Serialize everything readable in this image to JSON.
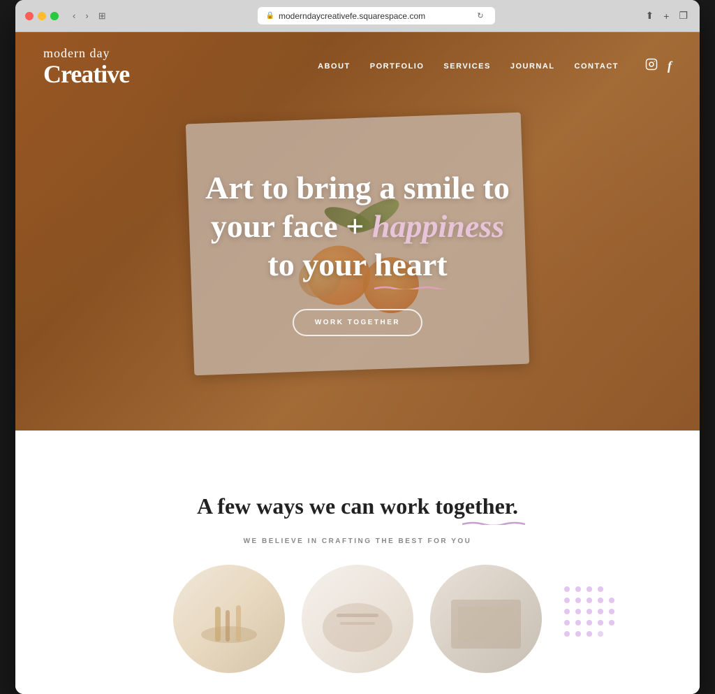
{
  "browser": {
    "url": "moderndaycreativefe.squarespace.com",
    "reload_label": "↻",
    "back_label": "‹",
    "forward_label": "›",
    "share_label": "⬆",
    "add_tab_label": "+",
    "duplicate_label": "❐",
    "window_icon_label": "⊞"
  },
  "site": {
    "logo_script": "modern day",
    "logo_serif": "Creative"
  },
  "nav": {
    "items": [
      {
        "label": "ABOUT",
        "id": "about"
      },
      {
        "label": "PORTFOLIO",
        "id": "portfolio"
      },
      {
        "label": "SERVICES",
        "id": "services"
      },
      {
        "label": "JOURNAL",
        "id": "journal"
      },
      {
        "label": "CONTACT",
        "id": "contact"
      }
    ],
    "social": [
      {
        "icon": "𝕀",
        "label": "Instagram",
        "id": "instagram"
      },
      {
        "icon": "f",
        "label": "Facebook",
        "id": "facebook"
      }
    ]
  },
  "hero": {
    "title_line1": "Art to bring a smile to",
    "title_line2": "your face + happiness",
    "title_line3": "to your heart",
    "cta_label": "WORK TOGETHER"
  },
  "below_fold": {
    "section_title": "A few ways we can work together.",
    "section_subtitle": "WE BELIEVE IN CRAFTING THE BEST FOR YOU"
  }
}
